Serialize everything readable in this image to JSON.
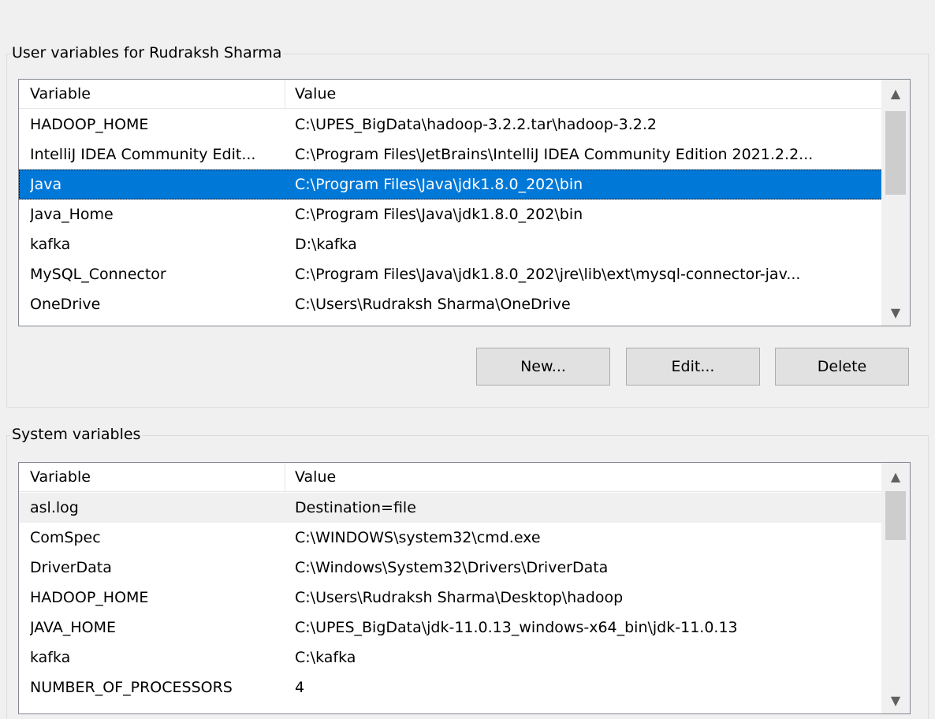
{
  "user_section": {
    "label": "User variables for Rudraksh Sharma",
    "columns": {
      "variable": "Variable",
      "value": "Value"
    },
    "rows": [
      {
        "variable": "HADOOP_HOME",
        "value": "C:\\UPES_BigData\\hadoop-3.2.2.tar\\hadoop-3.2.2"
      },
      {
        "variable": "IntelliJ IDEA Community Edit...",
        "value": "C:\\Program Files\\JetBrains\\IntelliJ IDEA Community Edition 2021.2.2..."
      },
      {
        "variable": "Java",
        "value": "C:\\Program Files\\Java\\jdk1.8.0_202\\bin"
      },
      {
        "variable": "Java_Home",
        "value": "C:\\Program Files\\Java\\jdk1.8.0_202\\bin"
      },
      {
        "variable": "kafka",
        "value": "D:\\kafka"
      },
      {
        "variable": "MySQL_Connector",
        "value": "C:\\Program Files\\Java\\jdk1.8.0_202\\jre\\lib\\ext\\mysql-connector-jav..."
      },
      {
        "variable": "OneDrive",
        "value": "C:\\Users\\Rudraksh Sharma\\OneDrive"
      }
    ],
    "selected_index": 2,
    "buttons": {
      "new": "New...",
      "edit": "Edit...",
      "delete": "Delete"
    }
  },
  "system_section": {
    "label": "System variables",
    "columns": {
      "variable": "Variable",
      "value": "Value"
    },
    "rows": [
      {
        "variable": "asl.log",
        "value": "Destination=file"
      },
      {
        "variable": "ComSpec",
        "value": "C:\\WINDOWS\\system32\\cmd.exe"
      },
      {
        "variable": "DriverData",
        "value": "C:\\Windows\\System32\\Drivers\\DriverData"
      },
      {
        "variable": "HADOOP_HOME",
        "value": "C:\\Users\\Rudraksh Sharma\\Desktop\\hadoop"
      },
      {
        "variable": "JAVA_HOME",
        "value": "C:\\UPES_BigData\\jdk-11.0.13_windows-x64_bin\\jdk-11.0.13"
      },
      {
        "variable": "kafka",
        "value": "C:\\kafka"
      },
      {
        "variable": "NUMBER_OF_PROCESSORS",
        "value": "4"
      }
    ],
    "hover_index": 0
  },
  "icons": {
    "scroll_up": "▲",
    "scroll_down": "▼"
  },
  "colors": {
    "selection": "#0078d7",
    "hover": "#f0f0f0"
  }
}
